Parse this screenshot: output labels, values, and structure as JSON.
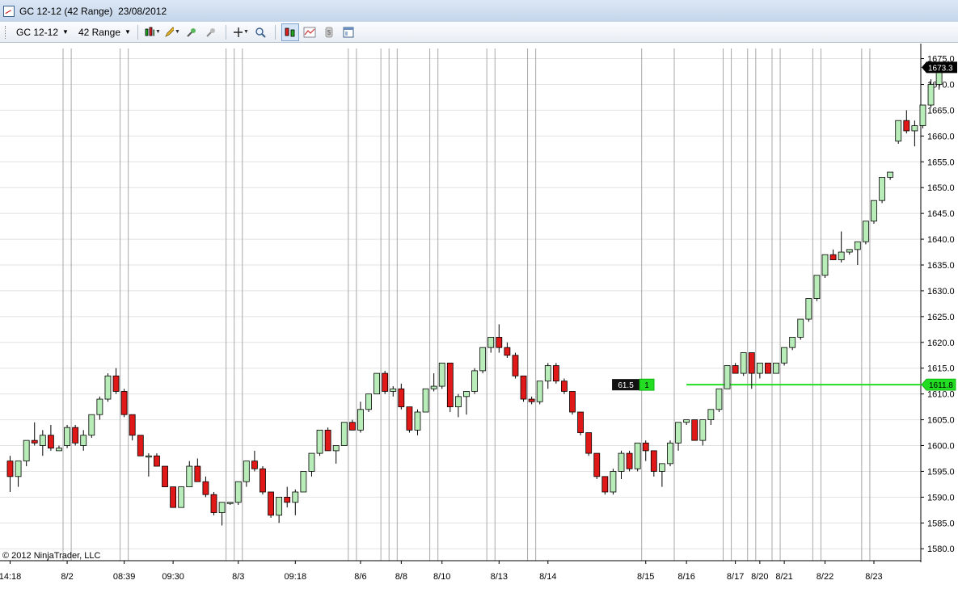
{
  "window": {
    "title": "GC 12-12 (42 Range)  23/08/2012"
  },
  "toolbar": {
    "instrument": "GC 12-12",
    "interval": "42 Range",
    "icons": [
      "bar-style-icon",
      "drawing-tool-icon",
      "snap-mode-icon",
      "global-link-icon",
      "crosshair-icon",
      "zoom-icon",
      "data-series-icon",
      "indicators-icon",
      "strategies-icon",
      "properties-icon"
    ]
  },
  "colors": {
    "up_body": "#b8ecb8",
    "down_body": "#e01818",
    "wick": "#000000",
    "price_line": "#22dd22",
    "grid": "#e2e2e2",
    "session_line": "#a8a8a8"
  },
  "chart_data": {
    "type": "candlestick",
    "ylim": [
      1578,
      1678
    ],
    "yticks": [
      1580,
      1585,
      1590,
      1595,
      1600,
      1605,
      1610,
      1615,
      1620,
      1625,
      1630,
      1635,
      1640,
      1645,
      1650,
      1655,
      1660,
      1665,
      1670,
      1675
    ],
    "ytick_labels": [
      "1580.0",
      "1585.0",
      "1590.0",
      "1595.0",
      "1600.0",
      "1605.0",
      "1610.0",
      "1615.0",
      "1620.0",
      "1625.0",
      "1630.0",
      "1635.0",
      "1640.0",
      "1645.0",
      "1650.0",
      "1655.0",
      "1660.0",
      "1665.0",
      "1670.0",
      "1675.0"
    ],
    "x_labels": [
      {
        "label": "14:18",
        "bar": 0
      },
      {
        "label": "8/2",
        "bar": 7
      },
      {
        "label": "08:39",
        "bar": 14
      },
      {
        "label": "09:30",
        "bar": 20
      },
      {
        "label": "8/3",
        "bar": 28
      },
      {
        "label": "09:18",
        "bar": 35
      },
      {
        "label": "8/6",
        "bar": 43
      },
      {
        "label": "8/8",
        "bar": 48
      },
      {
        "label": "8/10",
        "bar": 53
      },
      {
        "label": "8/13",
        "bar": 60
      },
      {
        "label": "8/14",
        "bar": 66
      },
      {
        "label": "8/15",
        "bar": 78
      },
      {
        "label": "8/16",
        "bar": 83
      },
      {
        "label": "8/17",
        "bar": 89
      },
      {
        "label": "8/20",
        "bar": 92
      },
      {
        "label": "8/21",
        "bar": 95
      },
      {
        "label": "8/22",
        "bar": 100
      },
      {
        "label": "8/23",
        "bar": 106
      }
    ],
    "session_breaks": [
      7,
      8,
      14,
      15,
      27,
      28,
      29,
      42,
      43,
      46,
      47,
      48,
      52,
      53,
      59,
      60,
      64,
      65,
      78,
      82,
      88,
      89,
      91,
      92,
      94,
      95,
      99,
      100,
      105,
      106
    ],
    "bars": [
      [
        1597,
        1598,
        1591,
        1594
      ],
      [
        1594,
        1597,
        1592,
        1597
      ],
      [
        1597,
        1601,
        1596,
        1601
      ],
      [
        1601,
        1604.5,
        1600,
        1600.5
      ],
      [
        1600,
        1603,
        1598,
        1602
      ],
      [
        1602,
        1604,
        1599,
        1599.5
      ],
      [
        1599,
        1600,
        1599,
        1599.5
      ],
      [
        1600,
        1604,
        1599.5,
        1603.5
      ],
      [
        1603.5,
        1604,
        1600,
        1600.5
      ],
      [
        1600,
        1603,
        1599,
        1602
      ],
      [
        1602,
        1606,
        1601.5,
        1606
      ],
      [
        1606,
        1609.5,
        1605,
        1609
      ],
      [
        1609,
        1614,
        1608.5,
        1613.5
      ],
      [
        1613.5,
        1615,
        1610,
        1610.5
      ],
      [
        1610.5,
        1611,
        1605.5,
        1606
      ],
      [
        1606,
        1606,
        1601,
        1602
      ],
      [
        1602,
        1602,
        1598,
        1598
      ],
      [
        1598,
        1598.5,
        1594,
        1598
      ],
      [
        1598,
        1598.5,
        1596,
        1596
      ],
      [
        1596,
        1596,
        1592,
        1592
      ],
      [
        1592,
        1592,
        1588,
        1588
      ],
      [
        1588,
        1592,
        1588,
        1592
      ],
      [
        1592,
        1597,
        1592,
        1596
      ],
      [
        1596,
        1597.5,
        1593,
        1593
      ],
      [
        1593,
        1594,
        1590,
        1590.5
      ],
      [
        1590.5,
        1591,
        1586.5,
        1587
      ],
      [
        1587,
        1589,
        1584.5,
        1589
      ],
      [
        1589,
        1589,
        1588.5,
        1589
      ],
      [
        1589,
        1593,
        1588.5,
        1593
      ],
      [
        1593,
        1597,
        1592,
        1597
      ],
      [
        1597,
        1599,
        1595,
        1595.5
      ],
      [
        1595.5,
        1596,
        1590.5,
        1591
      ],
      [
        1591,
        1591,
        1586,
        1586.5
      ],
      [
        1586.5,
        1590,
        1585,
        1590
      ],
      [
        1590,
        1592,
        1588,
        1589
      ],
      [
        1589,
        1591.5,
        1586.5,
        1591
      ],
      [
        1591,
        1595,
        1591,
        1595
      ],
      [
        1595,
        1598.5,
        1594,
        1598.5
      ],
      [
        1598.5,
        1603,
        1598,
        1603
      ],
      [
        1603,
        1603.5,
        1599,
        1599
      ],
      [
        1599,
        1600,
        1596.5,
        1600
      ],
      [
        1600,
        1604.5,
        1600,
        1604.5
      ],
      [
        1604.5,
        1605,
        1603,
        1603
      ],
      [
        1603,
        1608.5,
        1602.5,
        1607
      ],
      [
        1607,
        1610,
        1606.5,
        1610
      ],
      [
        1610,
        1614,
        1610,
        1614
      ],
      [
        1614,
        1614.5,
        1610,
        1610.5
      ],
      [
        1610.5,
        1611.5,
        1609.5,
        1611
      ],
      [
        1611,
        1612,
        1607,
        1607.5
      ],
      [
        1607.5,
        1607.5,
        1602.5,
        1603
      ],
      [
        1603,
        1607,
        1602,
        1606.5
      ],
      [
        1606.5,
        1611,
        1606.5,
        1611
      ],
      [
        1611,
        1614,
        1610.5,
        1611.5
      ],
      [
        1611.5,
        1616,
        1611,
        1616
      ],
      [
        1616,
        1616,
        1606.5,
        1607.5
      ],
      [
        1607.5,
        1610,
        1605.5,
        1609.5
      ],
      [
        1609.5,
        1610.5,
        1606,
        1610.5
      ],
      [
        1610.5,
        1615,
        1610,
        1614.5
      ],
      [
        1614.5,
        1619,
        1614,
        1619
      ],
      [
        1619,
        1621,
        1618,
        1621
      ],
      [
        1621,
        1623.5,
        1618,
        1619
      ],
      [
        1619,
        1620,
        1617,
        1617.5
      ],
      [
        1617.5,
        1618,
        1613,
        1613.5
      ],
      [
        1613.5,
        1613.5,
        1608.5,
        1609
      ],
      [
        1609,
        1609.5,
        1608,
        1608.5
      ],
      [
        1608.5,
        1612.5,
        1608,
        1612.5
      ],
      [
        1612.5,
        1616,
        1611,
        1615.5
      ],
      [
        1615.5,
        1616,
        1612,
        1612.5
      ],
      [
        1612.5,
        1613,
        1610,
        1610.5
      ],
      [
        1610.5,
        1610.5,
        1606,
        1606.5
      ],
      [
        1606.5,
        1606.5,
        1602,
        1602.5
      ],
      [
        1602.5,
        1602.5,
        1598,
        1598.5
      ],
      [
        1598.5,
        1598.5,
        1593.5,
        1594
      ],
      [
        1594,
        1594,
        1590.5,
        1591
      ],
      [
        1591,
        1595.5,
        1590.5,
        1595
      ],
      [
        1595,
        1599,
        1593.5,
        1598.5
      ],
      [
        1598.5,
        1599,
        1595,
        1595.5
      ],
      [
        1595.5,
        1600.5,
        1595,
        1600.5
      ],
      [
        1600.5,
        1601,
        1597,
        1599
      ],
      [
        1599,
        1599,
        1594,
        1595
      ],
      [
        1595,
        1596,
        1592,
        1596.5
      ],
      [
        1596.5,
        1601,
        1596,
        1600.5
      ],
      [
        1600.5,
        1604.5,
        1599,
        1604.5
      ],
      [
        1604.5,
        1605,
        1604,
        1605
      ],
      [
        1605,
        1605,
        1601,
        1601
      ],
      [
        1601,
        1605,
        1600,
        1605
      ],
      [
        1605,
        1607,
        1604,
        1607
      ],
      [
        1607,
        1611,
        1606.5,
        1611
      ],
      [
        1611,
        1615.5,
        1611,
        1615.5
      ],
      [
        1615.5,
        1616,
        1614,
        1614
      ],
      [
        1614,
        1618,
        1613.5,
        1618
      ],
      [
        1618,
        1618,
        1611,
        1614
      ],
      [
        1614,
        1616,
        1613,
        1616
      ],
      [
        1616,
        1616,
        1614,
        1614
      ],
      [
        1614,
        1616,
        1614,
        1616
      ],
      [
        1616,
        1619,
        1615.5,
        1619
      ],
      [
        1619,
        1621,
        1618.5,
        1621
      ],
      [
        1621,
        1624.5,
        1620.5,
        1624.5
      ],
      [
        1624.5,
        1628.5,
        1624,
        1628.5
      ],
      [
        1628.5,
        1633,
        1628,
        1633
      ],
      [
        1633,
        1637,
        1632.5,
        1637
      ],
      [
        1637,
        1638,
        1636,
        1636
      ],
      [
        1636,
        1641.5,
        1635.5,
        1637.5
      ],
      [
        1637.5,
        1638,
        1637,
        1638
      ],
      [
        1638,
        1639.5,
        1635,
        1639.5
      ],
      [
        1639.5,
        1643.5,
        1639,
        1643.5
      ],
      [
        1643.5,
        1647.5,
        1643,
        1647.5
      ],
      [
        1647.5,
        1652,
        1647,
        1652
      ],
      [
        1652,
        1653,
        1651.5,
        1653
      ],
      [
        1659,
        1663,
        1658.5,
        1663
      ],
      [
        1663,
        1665,
        1660.5,
        1661
      ],
      [
        1661,
        1663,
        1658,
        1662
      ],
      [
        1662,
        1666,
        1661.5,
        1666
      ],
      [
        1666,
        1671,
        1665.5,
        1670
      ],
      [
        1670,
        1673.5,
        1669,
        1673
      ],
      [
        1673,
        1673.5,
        1672.5,
        1673.3
      ]
    ],
    "last_price": 1673.3,
    "last_price_label": "1673.3",
    "position": {
      "price": 1611.8,
      "price_label": "1611.8",
      "pnl_label": "61.5",
      "qty_label": "1",
      "start_bar": 82
    },
    "annotations": [
      "© 2012 NinjaTrader, LLC"
    ]
  }
}
